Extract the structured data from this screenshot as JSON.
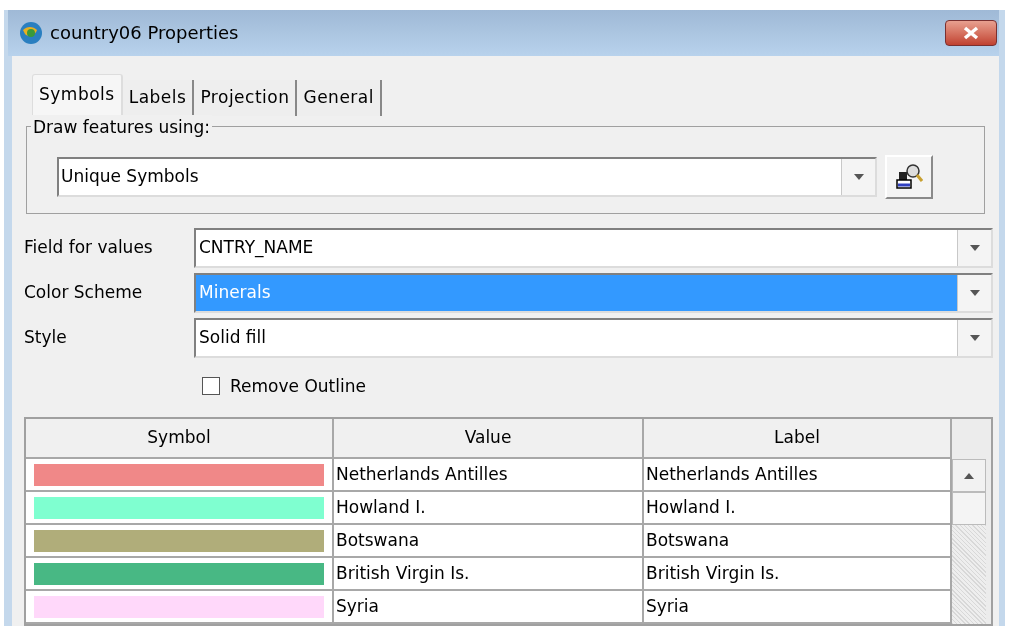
{
  "window": {
    "title": "country06 Properties"
  },
  "tabs": [
    {
      "label": "Symbols",
      "selected": true
    },
    {
      "label": "Labels",
      "selected": false
    },
    {
      "label": "Projection",
      "selected": false
    },
    {
      "label": "General",
      "selected": false
    }
  ],
  "draw_group": {
    "legend": "Draw features using:",
    "value": "Unique Symbols"
  },
  "fields": [
    {
      "label": "Field for values",
      "value": "CNTRY_NAME",
      "highlighted": false
    },
    {
      "label": "Color Scheme",
      "value": "Minerals",
      "highlighted": true
    },
    {
      "label": "Style",
      "value": "Solid fill",
      "highlighted": false
    }
  ],
  "remove_outline": {
    "label": "Remove Outline",
    "checked": false
  },
  "table": {
    "columns": [
      "Symbol",
      "Value",
      "Label"
    ],
    "rows": [
      {
        "color": "#f08888",
        "value": "Netherlands Antilles",
        "label": "Netherlands Antilles"
      },
      {
        "color": "#7fffd0",
        "value": "Howland I.",
        "label": "Howland I."
      },
      {
        "color": "#b0ad7a",
        "value": "Botswana",
        "label": "Botswana"
      },
      {
        "color": "#48b884",
        "value": "British Virgin Is.",
        "label": "British Virgin Is."
      },
      {
        "color": "#ffd8fa",
        "value": "Syria",
        "label": "Syria"
      }
    ]
  }
}
